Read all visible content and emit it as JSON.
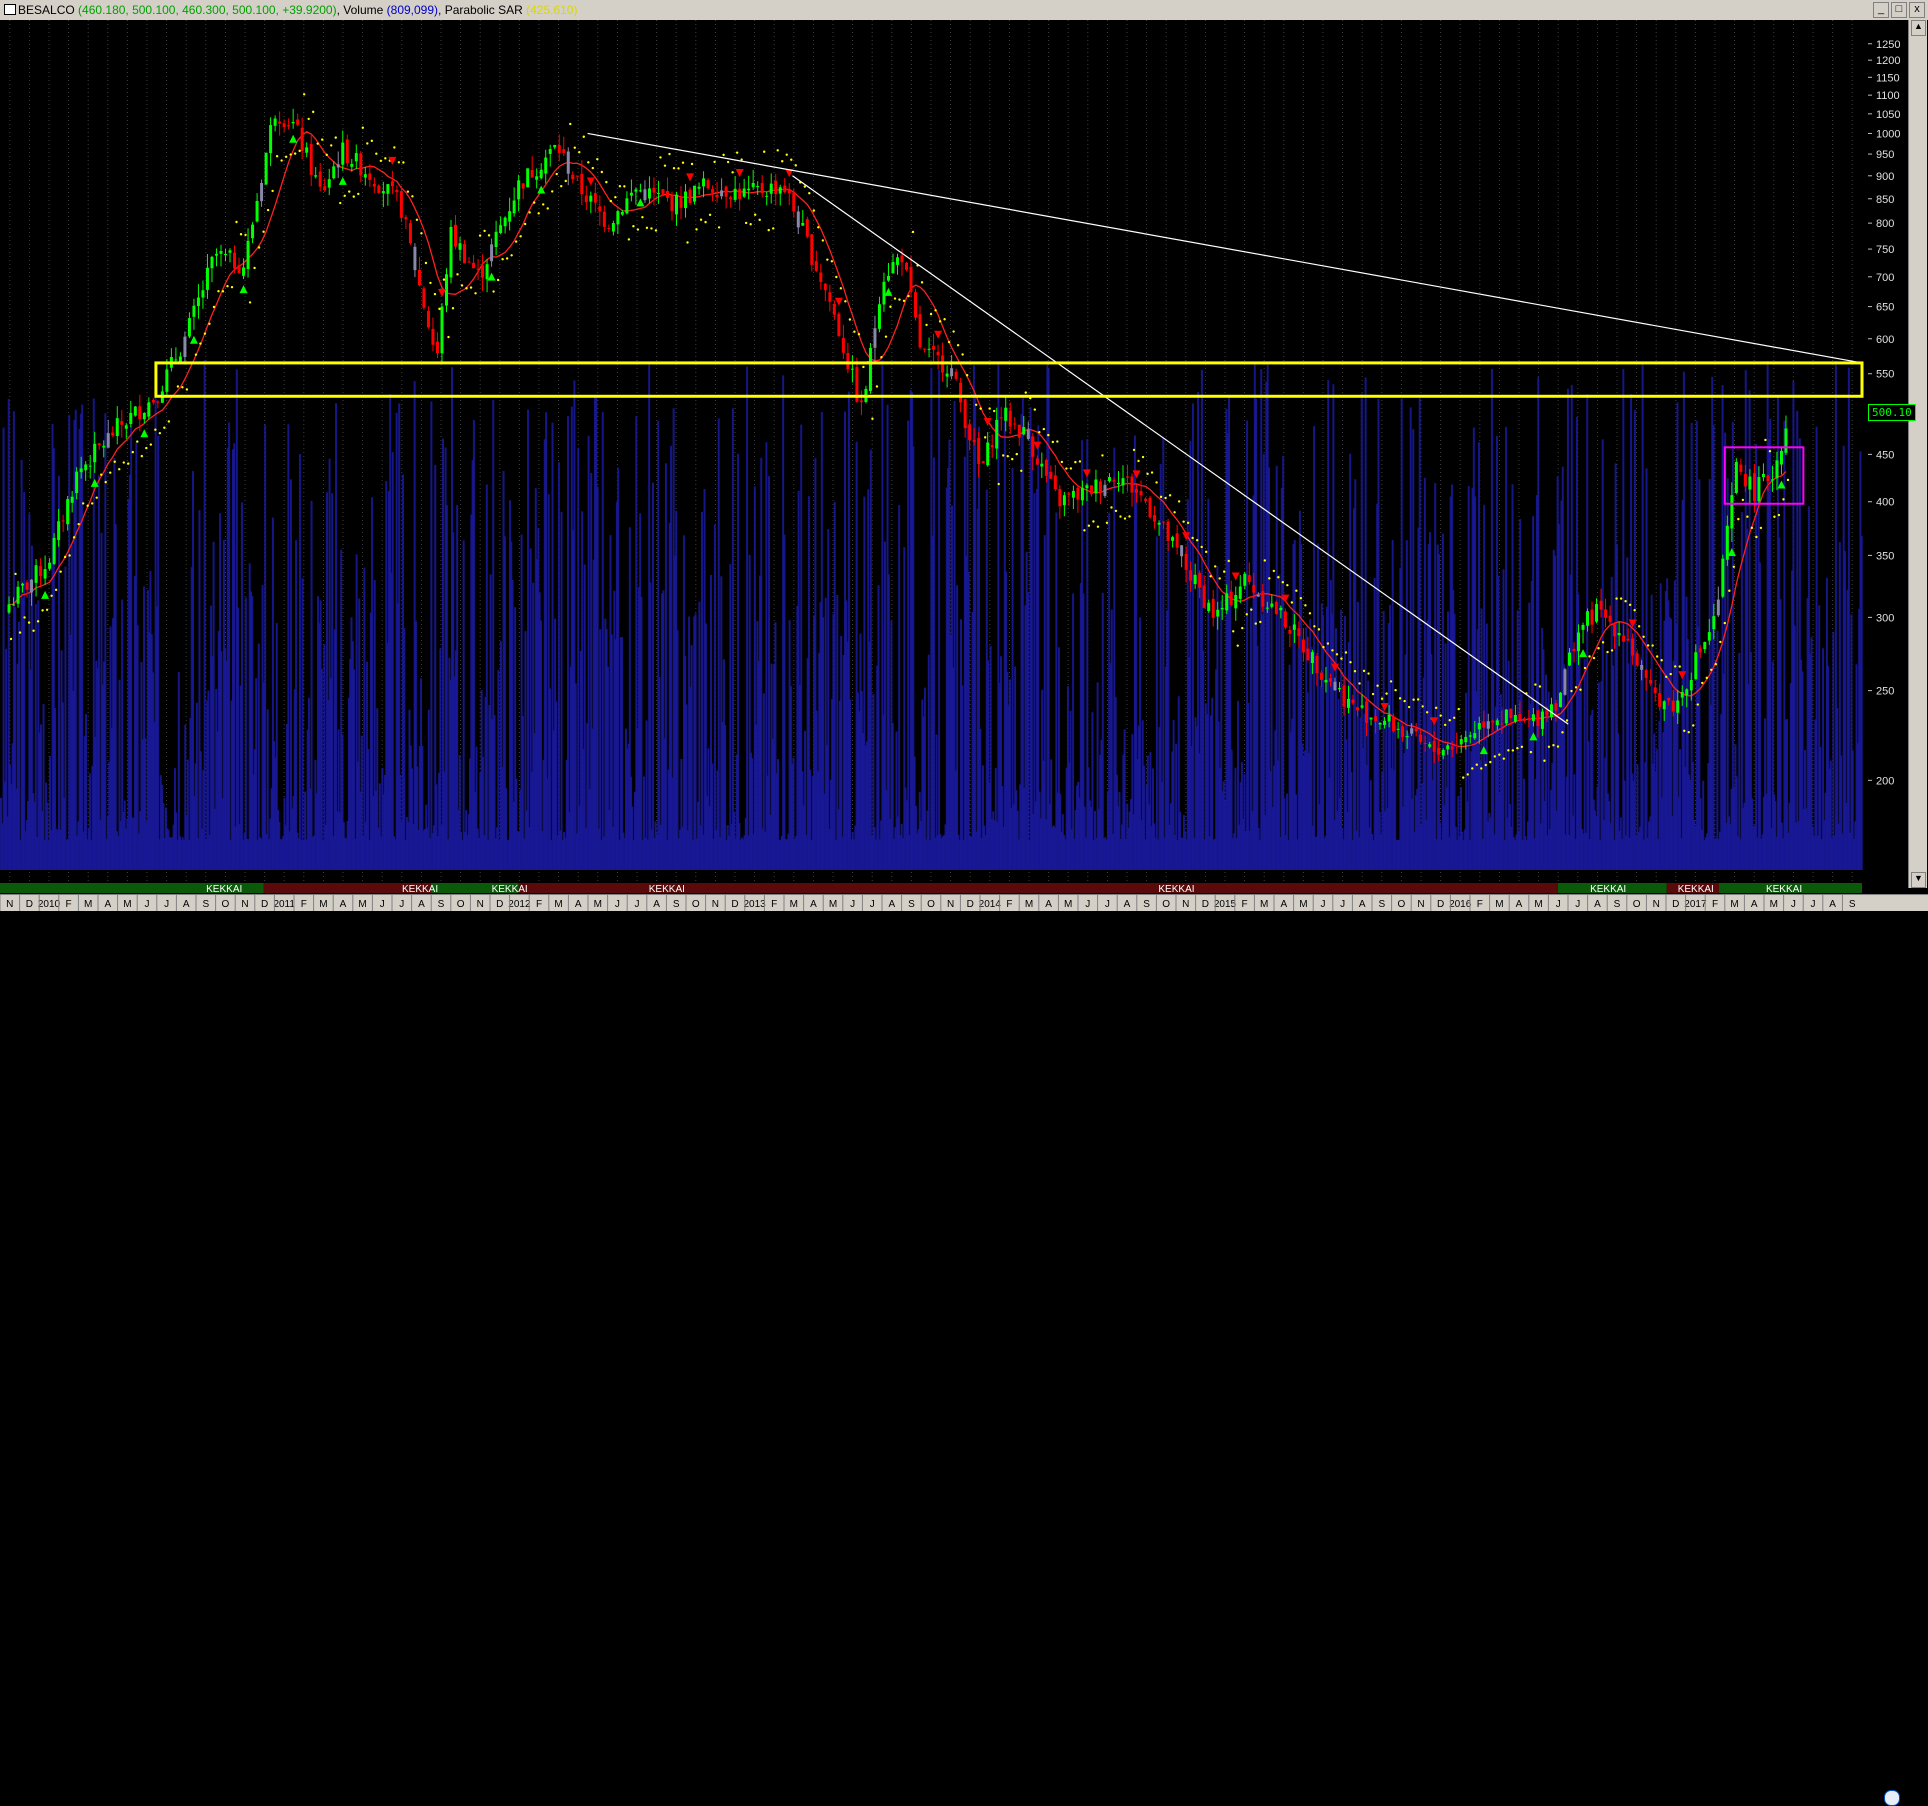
{
  "window": {
    "symbol": "BESALCO",
    "ohlc_text": "(460.180, 500.100, 460.300, 500.100, +39.9200)",
    "volume_label": "Volume",
    "volume_text": "(809,099)",
    "sar_label": "Parabolic SAR",
    "sar_text": "(425.610)",
    "min_label": "_",
    "max_label": "□",
    "close_label": "x"
  },
  "last_price_label": "500.10",
  "colors": {
    "background": "#000000",
    "up_candle": "#00ff00",
    "down_candle": "#ff0000",
    "neutral_candle": "#8888aa",
    "volume": "#1a1aa0",
    "sar_dots": "#ffff00",
    "moving_average": "#ff2020",
    "trendlines": "#ffffff",
    "zone": "#ffff00",
    "box": "#ff00ff",
    "grid": "#404040"
  },
  "chart_data": {
    "type": "candlestick",
    "y_scale": "log",
    "y_range": [
      160,
      1300
    ],
    "y_ticks": [
      1250,
      1200,
      1150,
      1100,
      1050,
      1000,
      950,
      900,
      850,
      800,
      750,
      700,
      650,
      600,
      550,
      450,
      400,
      350,
      300,
      250,
      200
    ],
    "x_range": [
      "2009-11",
      "2017-09"
    ],
    "x_ticks": [
      "N",
      "D",
      "2010",
      "F",
      "M",
      "A",
      "M",
      "J",
      "J",
      "A",
      "S",
      "O",
      "N",
      "D",
      "2011",
      "F",
      "M",
      "A",
      "M",
      "J",
      "J",
      "A",
      "S",
      "O",
      "N",
      "D",
      "2012",
      "F",
      "M",
      "A",
      "M",
      "J",
      "J",
      "A",
      "S",
      "O",
      "N",
      "D",
      "2013",
      "F",
      "M",
      "A",
      "M",
      "J",
      "J",
      "A",
      "S",
      "O",
      "N",
      "D",
      "2014",
      "F",
      "M",
      "A",
      "M",
      "J",
      "J",
      "A",
      "S",
      "O",
      "N",
      "D",
      "2015",
      "F",
      "M",
      "A",
      "M",
      "J",
      "J",
      "A",
      "S",
      "O",
      "N",
      "D",
      "2016",
      "F",
      "M",
      "A",
      "M",
      "J",
      "J",
      "A",
      "S",
      "O",
      "N",
      "D",
      "2017",
      "F",
      "M",
      "A",
      "M",
      "J",
      "J",
      "A",
      "S"
    ],
    "price_path": [
      {
        "t": "2009-11-15",
        "close": 310
      },
      {
        "t": "2010-01-15",
        "close": 345
      },
      {
        "t": "2010-03-01",
        "close": 430
      },
      {
        "t": "2010-05-01",
        "close": 480
      },
      {
        "t": "2010-07-01",
        "close": 520
      },
      {
        "t": "2010-08-15",
        "close": 600
      },
      {
        "t": "2010-10-01",
        "close": 740
      },
      {
        "t": "2010-11-15",
        "close": 720
      },
      {
        "t": "2011-01-01",
        "close": 1060
      },
      {
        "t": "2011-02-01",
        "close": 1020
      },
      {
        "t": "2011-03-15",
        "close": 860
      },
      {
        "t": "2011-04-15",
        "close": 960
      },
      {
        "t": "2011-06-01",
        "close": 900
      },
      {
        "t": "2011-07-15",
        "close": 840
      },
      {
        "t": "2011-08-15",
        "close": 680
      },
      {
        "t": "2011-09-10",
        "close": 570
      },
      {
        "t": "2011-10-01",
        "close": 780
      },
      {
        "t": "2011-11-15",
        "close": 700
      },
      {
        "t": "2012-01-15",
        "close": 880
      },
      {
        "t": "2012-03-15",
        "close": 970
      },
      {
        "t": "2012-04-15",
        "close": 880
      },
      {
        "t": "2012-06-01",
        "close": 800
      },
      {
        "t": "2012-07-15",
        "close": 870
      },
      {
        "t": "2012-09-15",
        "close": 840
      },
      {
        "t": "2012-11-01",
        "close": 880
      },
      {
        "t": "2013-01-01",
        "close": 860
      },
      {
        "t": "2013-03-01",
        "close": 880
      },
      {
        "t": "2013-04-01",
        "close": 780
      },
      {
        "t": "2013-05-15",
        "close": 650
      },
      {
        "t": "2013-07-01",
        "close": 500
      },
      {
        "t": "2013-08-01",
        "close": 700
      },
      {
        "t": "2013-09-01",
        "close": 740
      },
      {
        "t": "2013-10-01",
        "close": 580
      },
      {
        "t": "2013-11-15",
        "close": 560
      },
      {
        "t": "2014-01-01",
        "close": 430
      },
      {
        "t": "2014-02-01",
        "close": 500
      },
      {
        "t": "2014-03-15",
        "close": 470
      },
      {
        "t": "2014-05-01",
        "close": 400
      },
      {
        "t": "2014-06-15",
        "close": 410
      },
      {
        "t": "2014-08-01",
        "close": 430
      },
      {
        "t": "2014-09-15",
        "close": 400
      },
      {
        "t": "2014-11-15",
        "close": 340
      },
      {
        "t": "2015-01-01",
        "close": 300
      },
      {
        "t": "2015-02-15",
        "close": 330
      },
      {
        "t": "2015-04-15",
        "close": 300
      },
      {
        "t": "2015-06-01",
        "close": 270
      },
      {
        "t": "2015-08-01",
        "close": 240
      },
      {
        "t": "2015-10-01",
        "close": 230
      },
      {
        "t": "2015-12-01",
        "close": 215
      },
      {
        "t": "2016-01-15",
        "close": 220
      },
      {
        "t": "2016-03-01",
        "close": 235
      },
      {
        "t": "2016-05-01",
        "close": 230
      },
      {
        "t": "2016-06-15",
        "close": 245
      },
      {
        "t": "2016-07-15",
        "close": 290
      },
      {
        "t": "2016-08-15",
        "close": 305
      },
      {
        "t": "2016-10-01",
        "close": 285
      },
      {
        "t": "2016-11-01",
        "close": 250
      },
      {
        "t": "2016-12-15",
        "close": 240
      },
      {
        "t": "2017-01-15",
        "close": 270
      },
      {
        "t": "2017-02-15",
        "close": 300
      },
      {
        "t": "2017-03-20",
        "close": 440
      },
      {
        "t": "2017-04-15",
        "close": 410
      },
      {
        "t": "2017-05-15",
        "close": 430
      },
      {
        "t": "2017-06-10",
        "close": 500
      }
    ],
    "horizontal_zone": {
      "lower": 520,
      "upper": 565,
      "from": "2010-07-01",
      "to": "2017-09-30"
    },
    "trendlines": [
      {
        "from": {
          "t": "2012-05-01",
          "price": 1000
        },
        "to": {
          "t": "2017-09-30",
          "price": 565
        }
      },
      {
        "from": {
          "t": "2013-03-15",
          "price": 900
        },
        "to": {
          "t": "2016-07-01",
          "price": 230
        }
      }
    ],
    "box": {
      "from": "2017-03-01",
      "to": "2017-07-01",
      "low": 398,
      "high": 458
    },
    "signal_bands": [
      {
        "from": "2009-11-01",
        "to": "2010-12-15",
        "kind": "up"
      },
      {
        "from": "2010-12-15",
        "to": "2011-09-01",
        "kind": "down"
      },
      {
        "from": "2011-09-01",
        "to": "2012-01-15",
        "kind": "up"
      },
      {
        "from": "2012-01-15",
        "to": "2013-03-15",
        "kind": "down"
      },
      {
        "from": "2013-03-15",
        "to": "2016-06-15",
        "kind": "down"
      },
      {
        "from": "2016-06-15",
        "to": "2016-12-01",
        "kind": "up"
      },
      {
        "from": "2016-12-01",
        "to": "2017-02-20",
        "kind": "down"
      },
      {
        "from": "2017-02-20",
        "to": "2017-09-30",
        "kind": "up"
      }
    ],
    "signal_labels": [
      {
        "label": "KEKKAI",
        "t": "2010-10-15"
      },
      {
        "label": "KEKKAI",
        "t": "2011-08-15"
      },
      {
        "label": "KEKKAI",
        "t": "2012-01-01"
      },
      {
        "label": "KEKKAI",
        "t": "2012-09-01"
      },
      {
        "label": "KEKKAI",
        "t": "2014-11-01"
      },
      {
        "label": "KEKKAI",
        "t": "2016-09-01"
      },
      {
        "label": "KEKKAI",
        "t": "2017-01-15"
      },
      {
        "label": "KEKKAI",
        "t": "2017-06-01"
      }
    ]
  }
}
